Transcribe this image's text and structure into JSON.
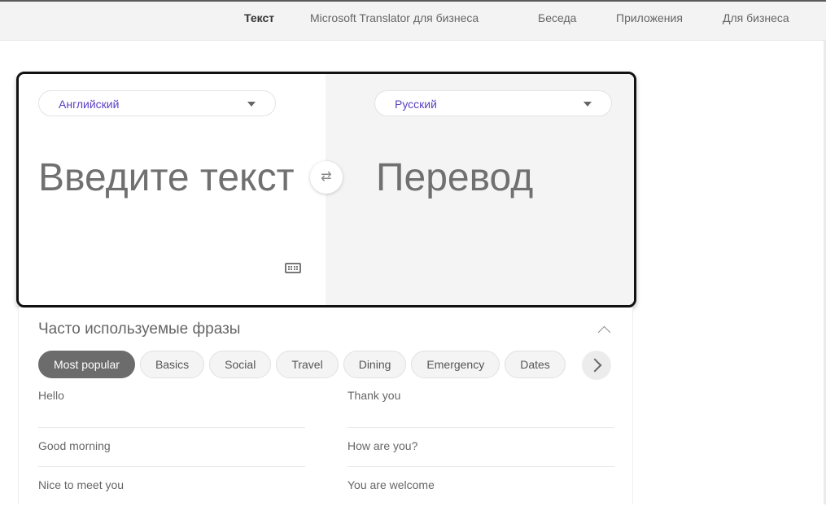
{
  "nav": {
    "items": [
      {
        "label": "Текст",
        "active": true
      },
      {
        "label": "Microsoft Translator для бизнеса",
        "active": false
      },
      {
        "label": "Беседа",
        "active": false
      },
      {
        "label": "Приложения",
        "active": false
      },
      {
        "label": "Для бизнеса",
        "active": false
      }
    ]
  },
  "translator": {
    "source_language": "Английский",
    "target_language": "Русский",
    "source_placeholder": "Введите текст",
    "target_placeholder": "Перевод",
    "swap_icon": "⇄",
    "keyboard_icon": "keyboard-icon"
  },
  "phrases": {
    "title": "Часто используемые фразы",
    "categories": [
      "Most popular",
      "Basics",
      "Social",
      "Travel",
      "Dining",
      "Emergency",
      "Dates"
    ],
    "active_category": "Most popular",
    "left_column": [
      "Hello",
      "Good morning",
      "Nice to meet you"
    ],
    "right_column": [
      "Thank you",
      "How are you?",
      "You are welcome"
    ]
  },
  "colors": {
    "language_label": "#5b3fc4",
    "active_chip": "#6c6c6c",
    "target_pane_bg": "#f4f4f4"
  }
}
